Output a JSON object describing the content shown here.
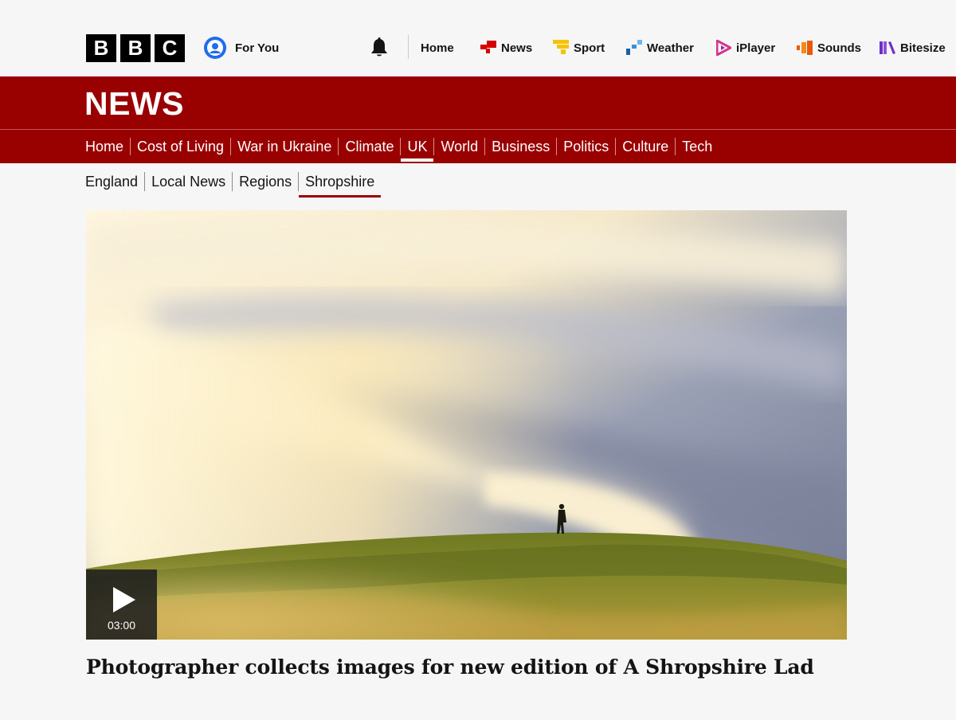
{
  "masthead": {
    "logo_letters": [
      "B",
      "B",
      "C"
    ],
    "for_you_label": "For You",
    "nav": [
      {
        "label": "Home",
        "icon": "none"
      },
      {
        "label": "News",
        "icon": "news-icon"
      },
      {
        "label": "Sport",
        "icon": "sport-icon"
      },
      {
        "label": "Weather",
        "icon": "weather-icon"
      },
      {
        "label": "iPlayer",
        "icon": "iplayer-icon"
      },
      {
        "label": "Sounds",
        "icon": "sounds-icon"
      },
      {
        "label": "Bitesize",
        "icon": "bitesize-icon"
      }
    ]
  },
  "banner": {
    "title": "NEWS"
  },
  "section_nav": {
    "items": [
      "Home",
      "Cost of Living",
      "War in Ukraine",
      "Climate",
      "UK",
      "World",
      "Business",
      "Politics",
      "Culture",
      "Tech"
    ],
    "active": "UK"
  },
  "sub_nav": {
    "items": [
      "England",
      "Local News",
      "Regions",
      "Shropshire"
    ],
    "active": "Shropshire"
  },
  "media": {
    "duration": "03:00",
    "icon": "play-icon"
  },
  "article": {
    "headline": "Photographer collects images for new edition of A Shropshire Lad"
  },
  "colors": {
    "brand_red": "#990000",
    "news_icon_red": "#d60000",
    "sport_yellow": "#f6c300",
    "weather_blue": "#3a8fd6",
    "iplayer_pink": "#d6348c",
    "sounds_orange": "#e8590c",
    "bitesize_purple": "#6f2fbf"
  }
}
